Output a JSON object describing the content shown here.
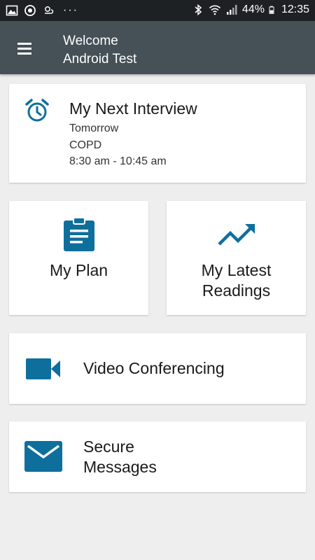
{
  "status_bar": {
    "battery": "44%",
    "time": "12:35",
    "left_icons": [
      "image-icon",
      "sync-icon",
      "weather-icon"
    ],
    "more": "···"
  },
  "app_bar": {
    "greeting": "Welcome",
    "user_name": "Android Test"
  },
  "interview": {
    "title": "My Next Interview",
    "day": "Tomorrow",
    "type": "COPD",
    "time": "8:30 am - 10:45 am"
  },
  "tiles": {
    "plan": {
      "label": "My Plan"
    },
    "readings": {
      "label_line1": "My Latest",
      "label_line2": "Readings"
    }
  },
  "rows": {
    "video": {
      "label": "Video Conferencing"
    },
    "messages": {
      "label_line1": "Secure",
      "label_line2": "Messages"
    }
  },
  "colors": {
    "accent": "#0e6f9c",
    "appbar": "#455057",
    "statusbar": "#1e2124",
    "background": "#eeeeee"
  }
}
